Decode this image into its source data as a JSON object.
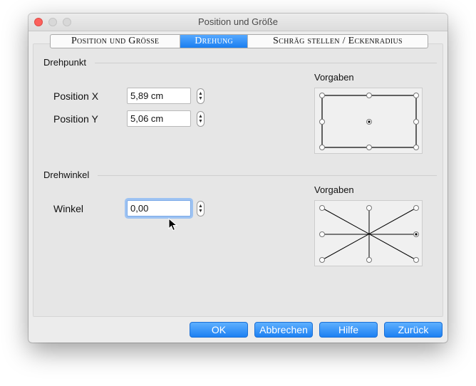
{
  "window": {
    "title": "Position und Größe"
  },
  "tabs": [
    {
      "label": "Position und Grösse",
      "active": false
    },
    {
      "label": "Drehung",
      "active": true
    },
    {
      "label": "Schräg stellen / Eckenradius",
      "active": false
    }
  ],
  "pivot": {
    "section_label": "Drehpunkt",
    "position_x_label": "Position X",
    "position_x_value": "5,89 cm",
    "position_y_label": "Position Y",
    "position_y_value": "5,06 cm",
    "presets_label": "Vorgaben"
  },
  "rotation": {
    "section_label": "Drehwinkel",
    "angle_label": "Winkel",
    "angle_value": "0,00",
    "presets_label": "Vorgaben"
  },
  "buttons": {
    "ok": "OK",
    "cancel": "Abbrechen",
    "help": "Hilfe",
    "reset": "Zurück"
  },
  "colors": {
    "accent": "#1a7ef0",
    "window_bg": "#ececec",
    "close_button": "#fc605c"
  }
}
